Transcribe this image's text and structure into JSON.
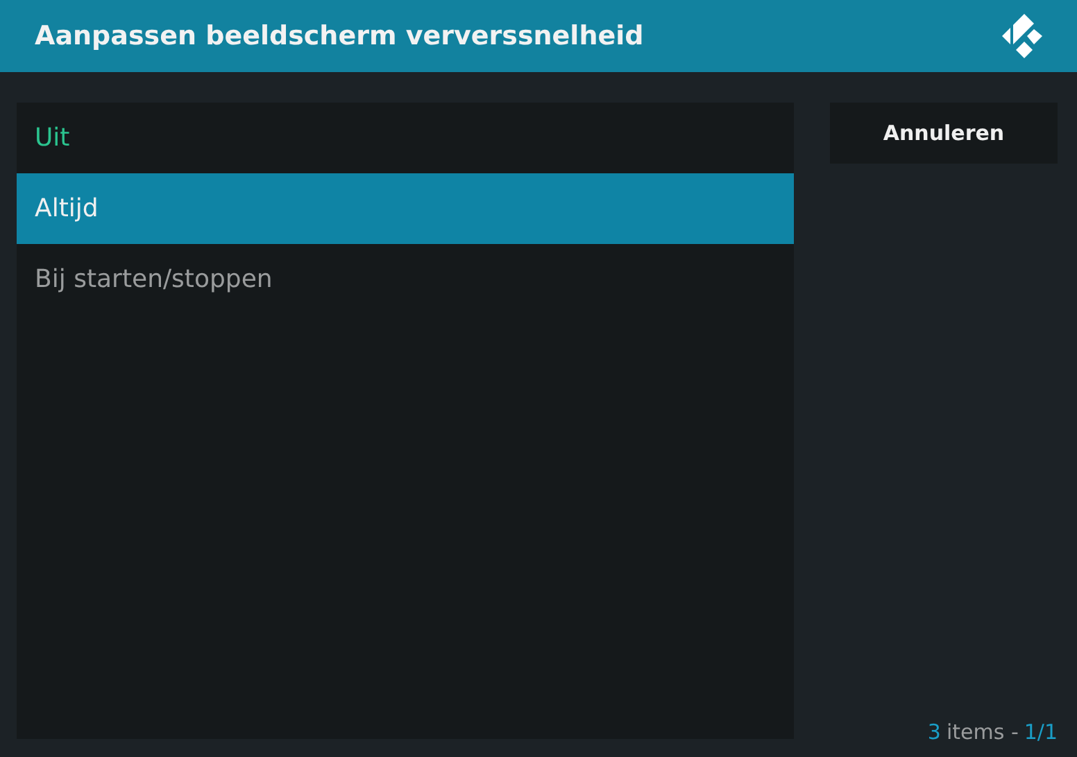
{
  "window": {
    "title": "Aanpassen beeldscherm ververssnelheid"
  },
  "options": [
    {
      "label": "Uit",
      "selected": true,
      "focused": false
    },
    {
      "label": "Altijd",
      "selected": false,
      "focused": true
    },
    {
      "label": "Bij starten/stoppen",
      "selected": false,
      "focused": false
    }
  ],
  "buttons": [
    "Annuleren"
  ],
  "footer": {
    "count": "3",
    "label": "items -",
    "page": "1/1"
  }
}
